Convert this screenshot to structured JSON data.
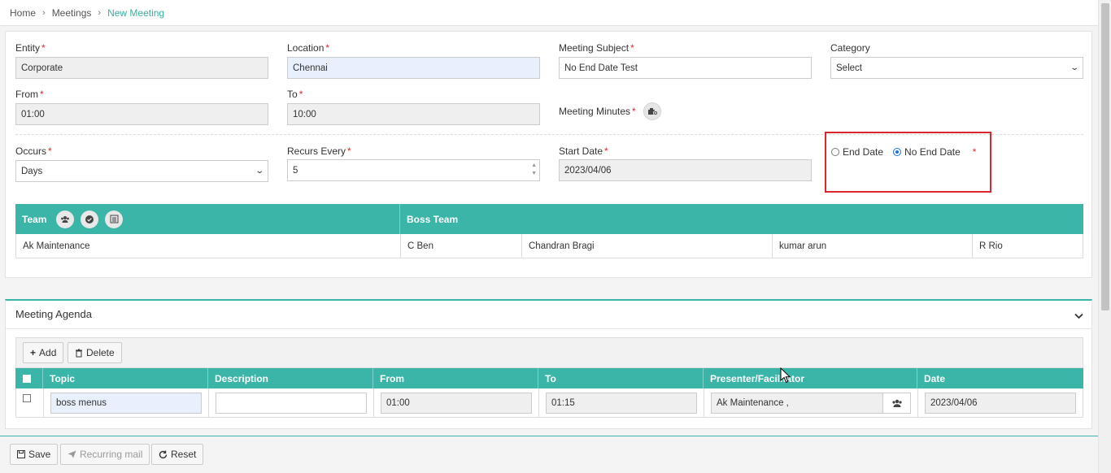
{
  "breadcrumb": {
    "home": "Home",
    "meetings": "Meetings",
    "current": "New Meeting"
  },
  "form": {
    "entity": {
      "label": "Entity",
      "value": "Corporate"
    },
    "location": {
      "label": "Location",
      "value": "Chennai"
    },
    "subject": {
      "label": "Meeting Subject",
      "value": "No End Date Test"
    },
    "category": {
      "label": "Category",
      "value": "Select"
    },
    "from": {
      "label": "From",
      "value": "01:00"
    },
    "to": {
      "label": "To",
      "value": "10:00"
    },
    "minutes": {
      "label": "Meeting Minutes"
    },
    "occurs": {
      "label": "Occurs",
      "value": "Days"
    },
    "recurs": {
      "label": "Recurs Every",
      "value": "5"
    },
    "start_date": {
      "label": "Start Date",
      "value": "2023/04/06"
    },
    "end_date_option": "End Date",
    "no_end_date_option": "No End Date",
    "required_mark": "*"
  },
  "team_table": {
    "team_header": "Team",
    "boss_header": "Boss Team",
    "team_value": "Ak Maintenance",
    "boss_members": [
      "C Ben",
      "Chandran Bragi",
      "kumar arun",
      "R Rio"
    ]
  },
  "agenda": {
    "title": "Meeting Agenda",
    "add_label": "Add",
    "delete_label": "Delete",
    "columns": [
      "Topic",
      "Description",
      "From",
      "To",
      "Presenter/Facilitator",
      "Date"
    ],
    "row": {
      "topic": "boss menus",
      "description": "",
      "from": "01:00",
      "to": "01:15",
      "presenter": "Ak Maintenance ,",
      "date": "2023/04/06"
    }
  },
  "footer": {
    "save": "Save",
    "recurring_mail": "Recurring mail",
    "reset": "Reset"
  },
  "colors": {
    "accent": "#3ab5a8",
    "required": "#d9262f",
    "highlight": "#d9262f"
  }
}
